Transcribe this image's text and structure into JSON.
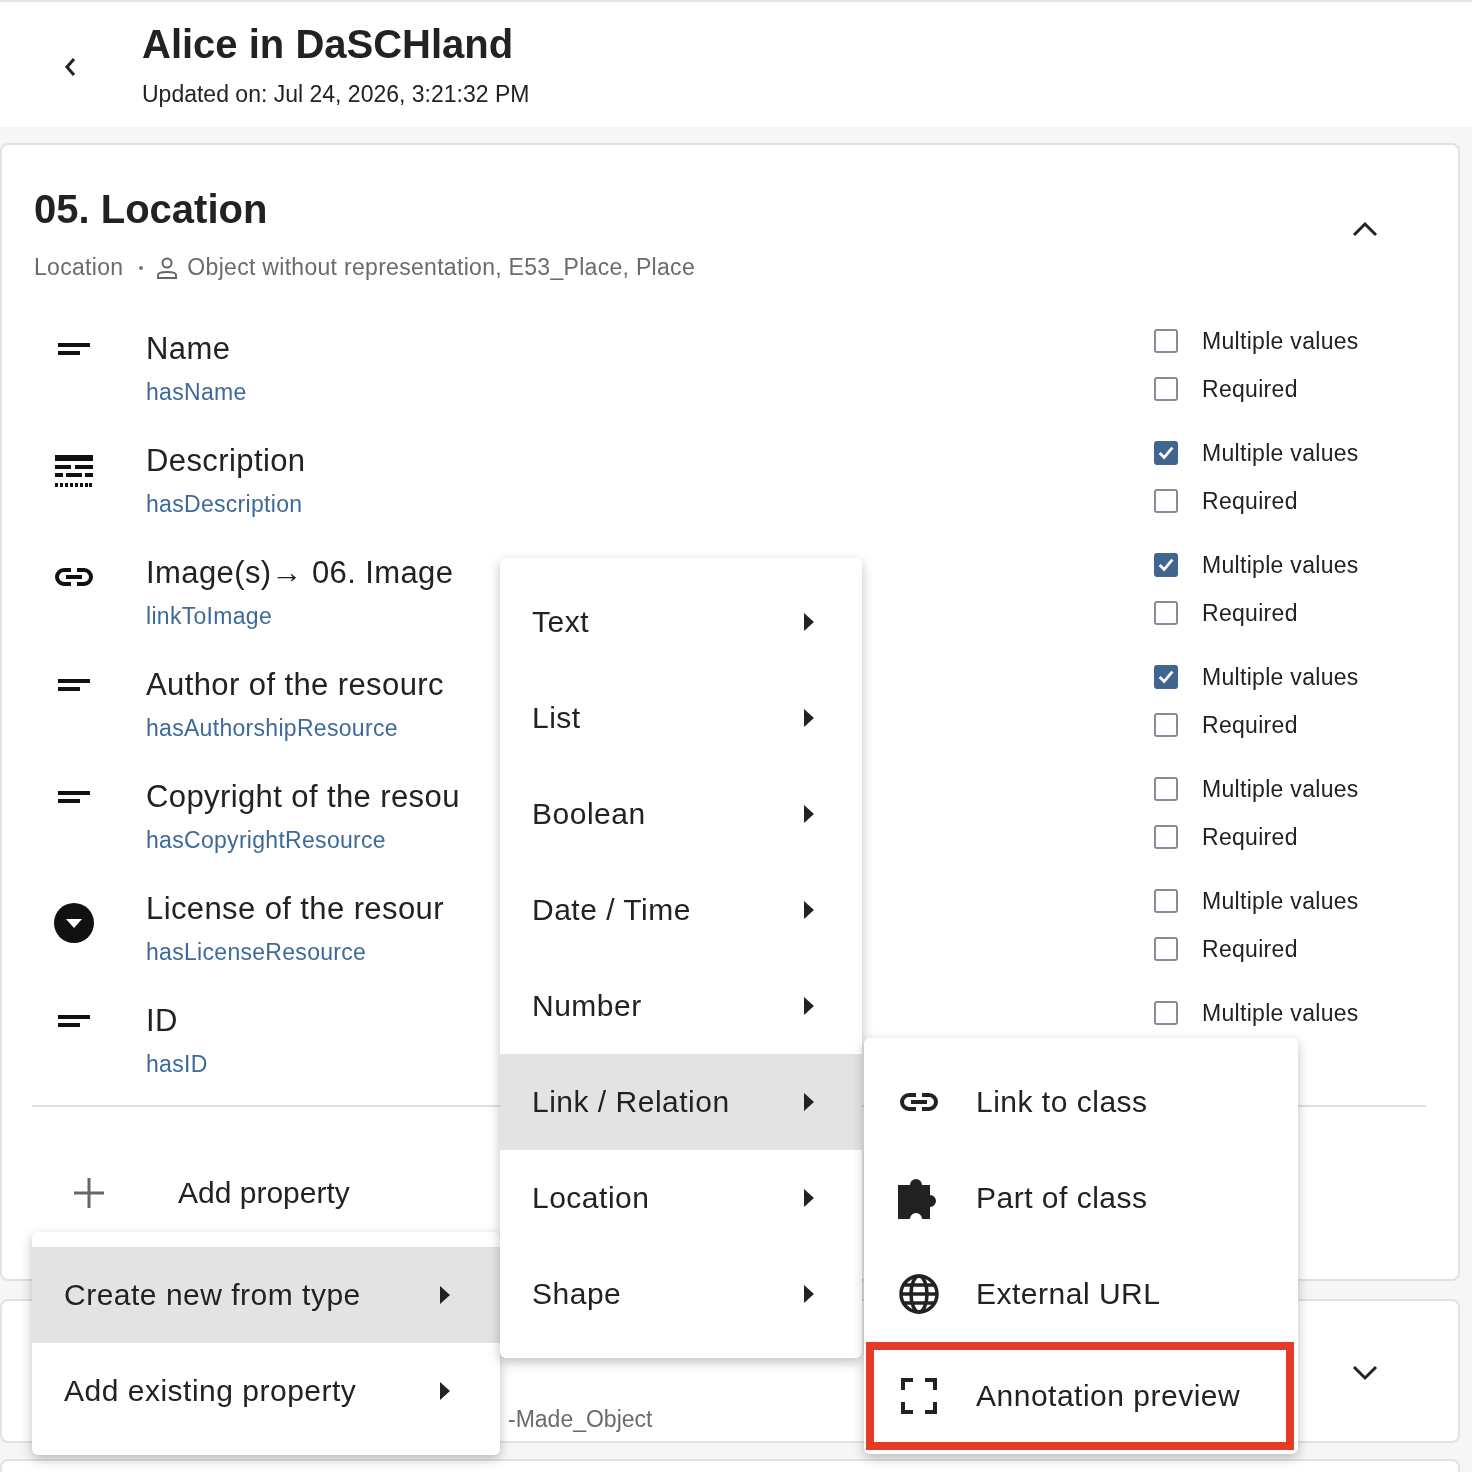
{
  "header": {
    "title": "Alice in DaSCHland",
    "updated": "Updated on: Jul 24, 2026, 3:21:32 PM"
  },
  "resource_class": {
    "title": "05. Location",
    "label": "Location",
    "types": "Object without representation, E53_Place, Place",
    "expanded": true,
    "properties": [
      {
        "kind": "text",
        "label": "Name",
        "name": "hasName",
        "multiple": {
          "label": "Multiple values",
          "checked": false
        },
        "required": {
          "label": "Required",
          "checked": false
        }
      },
      {
        "kind": "richtext",
        "label": "Description",
        "name": "hasDescription",
        "multiple": {
          "label": "Multiple values",
          "checked": true
        },
        "required": {
          "label": "Required",
          "checked": false
        }
      },
      {
        "kind": "link",
        "label": "Image(s)→ 06. Image",
        "name": "linkToImage",
        "multiple": {
          "label": "Multiple values",
          "checked": true
        },
        "required": {
          "label": "Required",
          "checked": false
        }
      },
      {
        "kind": "text",
        "label": "Author of the resourc",
        "name": "hasAuthorshipResource",
        "multiple": {
          "label": "Multiple values",
          "checked": true
        },
        "required": {
          "label": "Required",
          "checked": false
        }
      },
      {
        "kind": "text",
        "label": "Copyright of the resou",
        "name": "hasCopyrightResource",
        "multiple": {
          "label": "Multiple values",
          "checked": false
        },
        "required": {
          "label": "Required",
          "checked": false
        }
      },
      {
        "kind": "list",
        "label": "License of the resour",
        "name": "hasLicenseResource",
        "multiple": {
          "label": "Multiple values",
          "checked": false
        },
        "required": {
          "label": "Required",
          "checked": false
        }
      },
      {
        "kind": "text",
        "label": "ID",
        "name": "hasID",
        "multiple": {
          "label": "Multiple values",
          "checked": false
        }
      }
    ],
    "add_property": "Add property"
  },
  "next_class": {
    "types": "-Made_Object",
    "expanded": false
  },
  "add_menu": [
    {
      "label": "Create new from type",
      "selected": true
    },
    {
      "label": "Add existing property",
      "selected": false
    }
  ],
  "type_menu": [
    {
      "label": "Text",
      "selected": false
    },
    {
      "label": "List",
      "selected": false
    },
    {
      "label": "Boolean",
      "selected": false
    },
    {
      "label": "Date / Time",
      "selected": false
    },
    {
      "label": "Number",
      "selected": false
    },
    {
      "label": "Link / Relation",
      "selected": true
    },
    {
      "label": "Location",
      "selected": false
    },
    {
      "label": "Shape",
      "selected": false
    }
  ],
  "link_menu": [
    {
      "kind": "link",
      "label": "Link to class",
      "highlighted": false
    },
    {
      "kind": "puzzle",
      "label": "Part of class",
      "highlighted": false
    },
    {
      "kind": "globe",
      "label": "External URL",
      "highlighted": false
    },
    {
      "kind": "frame",
      "label": "Annotation preview",
      "highlighted": true
    }
  ]
}
